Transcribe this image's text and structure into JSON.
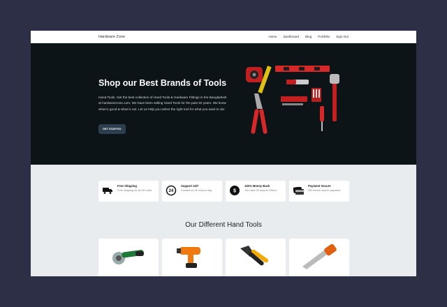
{
  "nav": {
    "brand": "Hardware Zone",
    "links": [
      "Home",
      "Dashboard",
      "Blog",
      "Portfolio",
      "Sign Out"
    ]
  },
  "hero": {
    "title": "Shop our Best Brands of Tools",
    "body": "Hand Tools. Get the best collection of Hand Tools & Hardware Fittings in the Bangladesh at hardwarezone.com. We have been selling Hand Tools for the past 40 years. We know what is good & what is not. Let us help you select the right tool for what you want to do!",
    "button": "GET STARTED"
  },
  "features": [
    {
      "title": "Free Shipping",
      "desc": "Free shipping on all US order",
      "icon": "truck-icon"
    },
    {
      "title": "Support 24/7",
      "desc": "Contact us 24 hours a day",
      "icon": "support-24-icon"
    },
    {
      "title": "100% Money Back",
      "desc": "You have 30 days to Return",
      "icon": "money-back-icon"
    },
    {
      "title": "Payment Secure",
      "desc": "We ensure secure payment",
      "icon": "credit-card-icon"
    }
  ],
  "products_section": {
    "title": "Our Different Hand Tools",
    "items": [
      {
        "icon": "angle-grinder-icon"
      },
      {
        "icon": "drill-icon"
      },
      {
        "icon": "pliers-icon"
      },
      {
        "icon": "hand-saw-icon"
      }
    ]
  },
  "colors": {
    "page_bg": "#2c2f45",
    "hero_bg": "#0c1418",
    "section_bg": "#e9ecef",
    "accent_red": "#d62828",
    "button_bg": "#2d3e4f"
  }
}
